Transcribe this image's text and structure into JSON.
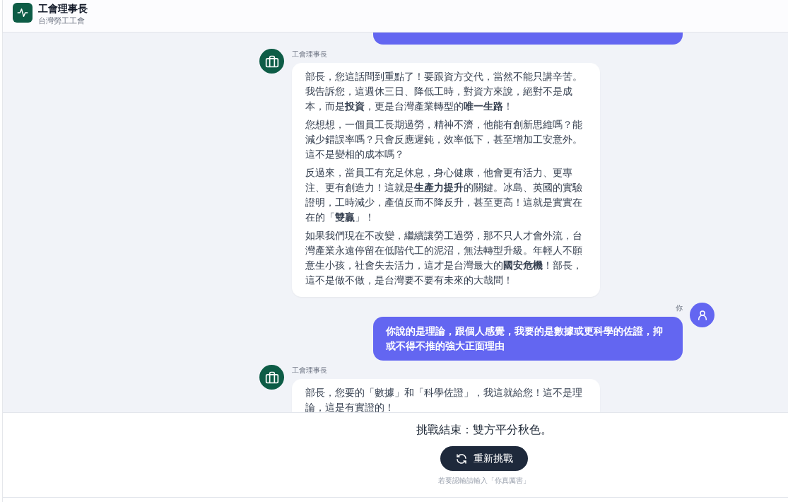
{
  "header": {
    "title": "工會理事長",
    "subtitle": "台灣勞工工會"
  },
  "messages": [
    {
      "kind": "user"
    },
    {
      "kind": "bot",
      "sender": "工會理事長",
      "paragraphs": [
        "部長，您這話問到重點了！要跟資方交代，當然不能只講辛苦。我告訴您，這週休三日、降低工時，對資方來說，絕對不是成本，而是**投資**，更是台灣產業轉型的**唯一生路**！",
        "您想想，一個員工長期過勞，精神不濟，他能有創新思維嗎？能減少錯誤率嗎？只會反應遲鈍，效率低下，甚至增加工安意外。這不是變相的成本嗎？",
        "反過來，當員工有充足休息，身心健康，他會更有活力、更專注、更有創造力！這就是**生產力提升**的關鍵。冰島、英國的實驗證明，工時減少，產值反而不降反升，甚至更高！這就是實實在在的「**雙贏**」！",
        "如果我們現在不改變，繼續讓勞工過勞，那不只人才會外流，台灣產業永遠停留在低階代工的泥沼，無法轉型升級。年輕人不願意生小孩，社會失去活力，這才是台灣最大的**國安危機**！部長，這不是做不做，是台灣要不要有未來的大哉問！"
      ]
    },
    {
      "kind": "user",
      "sender": "你",
      "paragraphs": [
        "你說的是理論，跟個人感覺，我要的是數據或更科學的佐證，抑或不得不推的強大正面理由"
      ]
    },
    {
      "kind": "bot",
      "sender": "工會理事長",
      "paragraphs": [
        "部長，您要的「數據」和「科學佐證」，我這就給您！這不是理論，這是有實證的！"
      ]
    }
  ],
  "footer": {
    "result": "挑戰結束：雙方平分秋色。",
    "button": "重新挑戰",
    "hint": "若要認輸請輸入「你真厲害」"
  }
}
